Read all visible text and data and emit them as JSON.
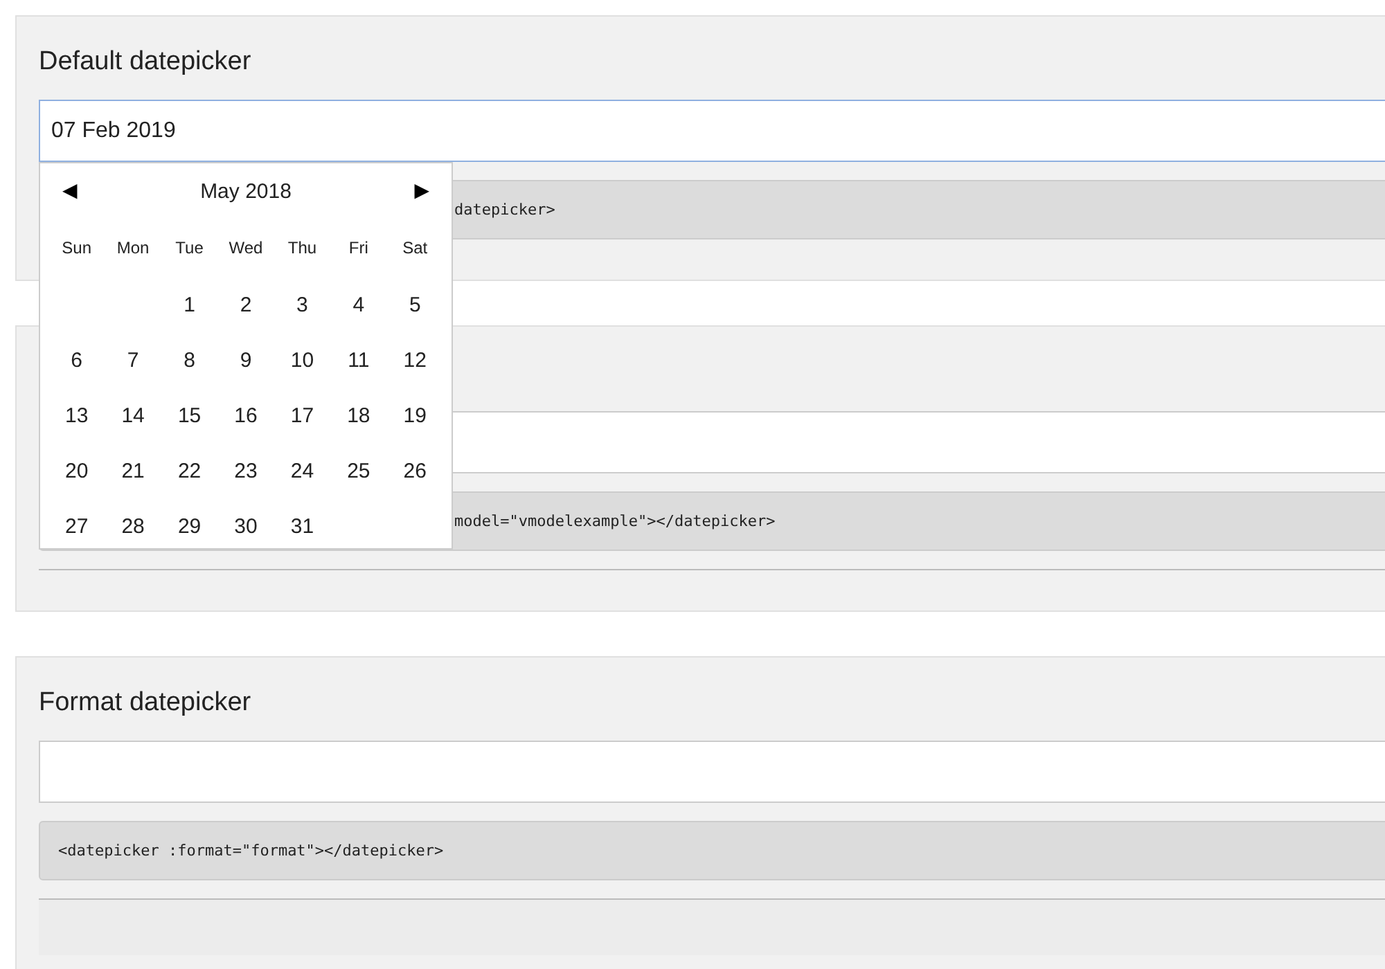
{
  "sections": [
    {
      "title": "Default datepicker",
      "input": {
        "value": "07 Feb 2019",
        "focused": true
      },
      "code": "datepicker>",
      "divider": false
    },
    {
      "input": {
        "focused": false
      },
      "code": "model=\"vmodelexample\"></datepicker>",
      "divider": true
    },
    {
      "title": "Format datepicker",
      "input": {
        "focused": false
      },
      "code": "<datepicker :format=\"format\"></datepicker>",
      "divider": true
    }
  ],
  "calendar": {
    "prev": "◀",
    "month": "May 2018",
    "next": "▶",
    "weekdays": [
      "Sun",
      "Mon",
      "Tue",
      "Wed",
      "Thu",
      "Fri",
      "Sat"
    ],
    "weeks": [
      [
        "1",
        "2",
        "3",
        "4",
        "5"
      ],
      [
        "6",
        "7",
        "8",
        "9",
        "10",
        "11",
        "12"
      ],
      [
        "13",
        "14",
        "15",
        "16",
        "17",
        "18",
        "19"
      ],
      [
        "20",
        "21",
        "22",
        "23",
        "24",
        "25",
        "26"
      ],
      [
        "27",
        "28",
        "29",
        "30",
        "31"
      ]
    ]
  }
}
